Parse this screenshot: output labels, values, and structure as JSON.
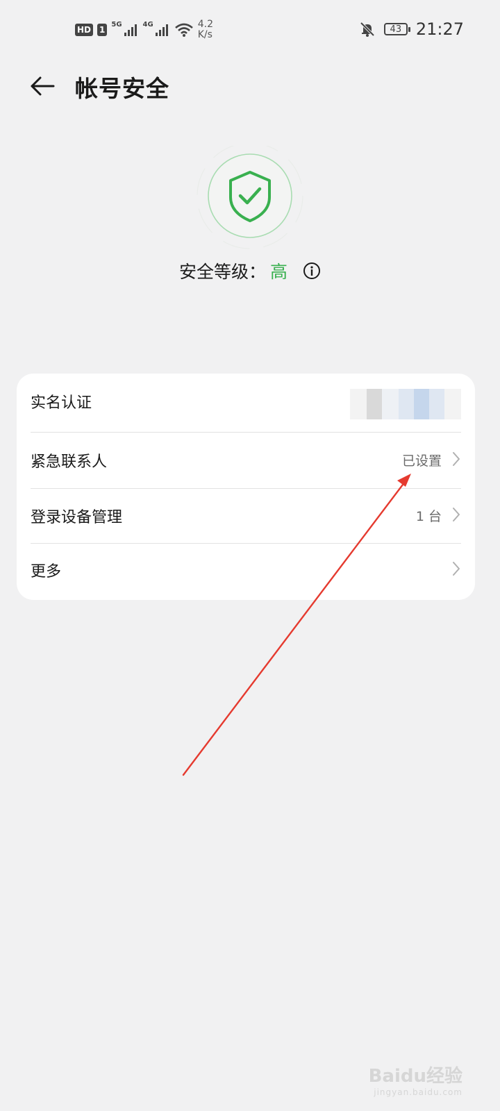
{
  "status_bar": {
    "hd": "HD",
    "sim": "1",
    "net1": "5G",
    "net2": "4G",
    "speed_value": "4.2",
    "speed_unit": "K/s",
    "battery": "43",
    "time": "21:27"
  },
  "header": {
    "title": "帐号安全"
  },
  "security": {
    "label": "安全等级：",
    "level": "高",
    "accent_color": "#39b04f"
  },
  "settings": {
    "items": [
      {
        "label": "实名认证",
        "value": ""
      },
      {
        "label": "紧急联系人",
        "value": "已设置"
      },
      {
        "label": "登录设备管理",
        "value": "1 台"
      },
      {
        "label": "更多",
        "value": ""
      }
    ]
  },
  "watermark": {
    "brand": "Baidu经验",
    "url": "jingyan.baidu.com"
  }
}
